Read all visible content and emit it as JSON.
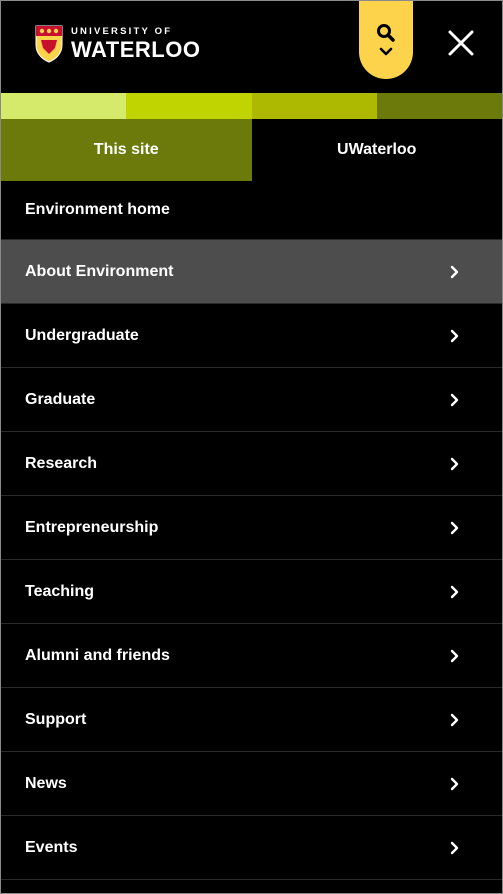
{
  "header": {
    "logo_small": "UNIVERSITY OF",
    "logo_big": "WATERLOO"
  },
  "colorbar": [
    "#d5ea6b",
    "#bfd400",
    "#adb900",
    "#6b7a0b"
  ],
  "tabs": [
    {
      "label": "This site",
      "active": true
    },
    {
      "label": "UWaterloo",
      "active": false
    }
  ],
  "menu": {
    "items": [
      {
        "label": "Environment home",
        "has_children": false,
        "active": false
      },
      {
        "label": "About Environment",
        "has_children": true,
        "active": true
      },
      {
        "label": "Undergraduate",
        "has_children": true,
        "active": false
      },
      {
        "label": "Graduate",
        "has_children": true,
        "active": false
      },
      {
        "label": "Research",
        "has_children": true,
        "active": false
      },
      {
        "label": "Entrepreneurship",
        "has_children": true,
        "active": false
      },
      {
        "label": "Teaching",
        "has_children": true,
        "active": false
      },
      {
        "label": "Alumni and friends",
        "has_children": true,
        "active": false
      },
      {
        "label": "Support",
        "has_children": true,
        "active": false
      },
      {
        "label": "News",
        "has_children": true,
        "active": false
      },
      {
        "label": "Events",
        "has_children": true,
        "active": false
      }
    ]
  },
  "icons": {
    "search": "search-icon",
    "dropdown": "chevron-down-icon",
    "close": "close-icon",
    "item": "chevron-right-icon"
  }
}
